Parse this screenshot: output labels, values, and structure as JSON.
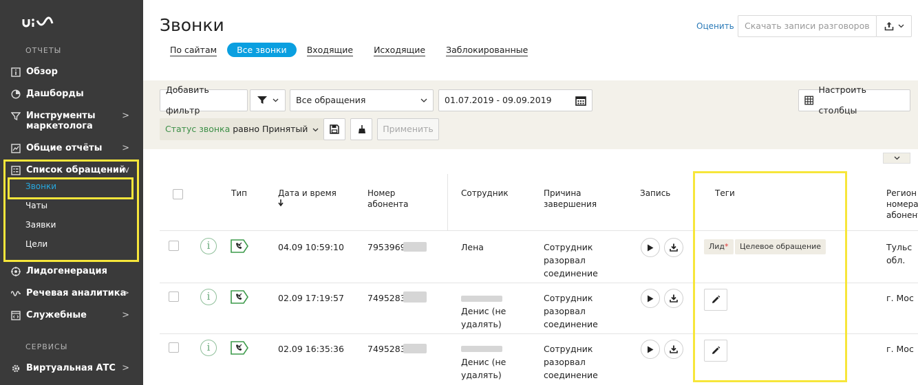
{
  "sidebar": {
    "logo": "uiss",
    "section_reports": "ОТЧЕТЫ",
    "section_services": "СЕРВИСЫ",
    "items": {
      "overview": "Обзор",
      "dashboards": "Дашборды",
      "marketing_tools": "Инструменты маркетолога",
      "general_reports": "Общие отчёты",
      "requests_list": "Список обращений",
      "leadgen": "Лидогенерация",
      "speech_analytics": "Речевая аналитика",
      "service": "Служебные",
      "virtual_ats": "Виртуальная АТС"
    },
    "sub_items": {
      "calls": "Звонки",
      "chats": "Чаты",
      "orders": "Заявки",
      "goals": "Цели"
    },
    "arrow_right": ">",
    "arrow_down": "v",
    "highlight_color": "#f7e63a",
    "active_color": "#27a9e1"
  },
  "header": {
    "title": "Звонки",
    "tabs": [
      "По сайтам",
      "Все звонки",
      "Входящие",
      "Исходящие",
      "Заблокированные"
    ],
    "rate_link": "Оценить",
    "download_button": "Скачать записи разговоров"
  },
  "filters": {
    "add_filter": "Добавить фильтр",
    "requests_select": "Все обращения",
    "date_range": "01.07.2019 - 09.09.2019",
    "configure_columns": "Настроить столбцы",
    "status_label": "Статус звонка",
    "status_value": "равно Принятый",
    "apply": "Применить"
  },
  "table": {
    "headers": {
      "type": "Тип",
      "datetime": "Дата и время",
      "subscriber": "Номер абонента",
      "employee": "Сотрудник",
      "reason": "Причина завершения",
      "record": "Запись",
      "tags": "Теги",
      "region": "Регион номера абонента"
    },
    "rows": [
      {
        "datetime": "04.09 10:59:10",
        "number": "7953969",
        "employee": "Лена",
        "reason": "Сотрудник разорвал соединение",
        "tags": [
          "Лид",
          "Целевое обращение"
        ],
        "region": "Тульс обл."
      },
      {
        "datetime": "02.09 17:19:57",
        "number": "7495283",
        "employee": "Денис (не удалять)",
        "reason": "Сотрудник разорвал соединение",
        "tags": [],
        "region": "г. Мос"
      },
      {
        "datetime": "02.09 16:35:36",
        "number": "7495283",
        "employee": "Денис (не удалять)",
        "reason": "Сотрудник разорвал соединение",
        "tags": [],
        "region": "г. Мос"
      }
    ],
    "required_mark": "*"
  },
  "colors": {
    "accent": "#0a9fe0",
    "sidebar_bg": "#3a3a3a",
    "call_icon_green": "#3c9a4a"
  }
}
